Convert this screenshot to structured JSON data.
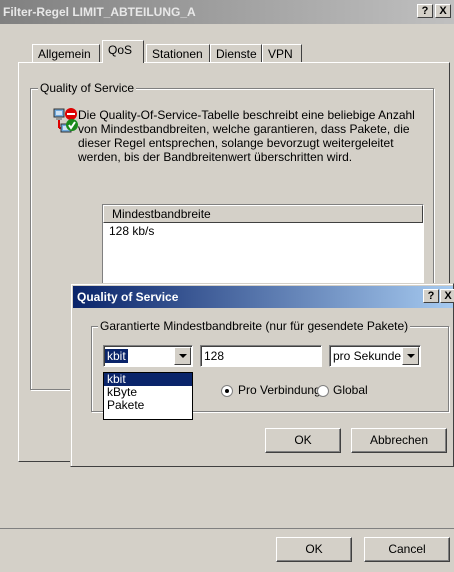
{
  "main_window": {
    "title": "Filter-Regel LIMIT_ABTEILUNG_A",
    "help_button": "?",
    "close_button": "X",
    "tabs": [
      {
        "label": "Allgemein"
      },
      {
        "label": "QoS"
      },
      {
        "label": "Stationen"
      },
      {
        "label": "Dienste"
      },
      {
        "label": "VPN"
      }
    ],
    "group_title": "Quality of Service",
    "description": "Die Quality-Of-Service-Tabelle beschreibt eine beliebige Anzahl von Mindestbandbreiten, welche garantieren, dass Pakete, die dieser Regel entsprechen, solange bevorzugt weitergeleitet werden, bis der Bandbreitenwert überschritten wird.",
    "table": {
      "column_header": "Mindestbandbreite",
      "rows": [
        "128 kb/s"
      ]
    },
    "ok_button": "OK",
    "cancel_button": "Cancel"
  },
  "dialog": {
    "title": "Quality of Service",
    "help_button": "?",
    "close_button": "X",
    "group_title": "Garantierte Mindestbandbreite (nur für gesendete Pakete)",
    "unit_selected": "kbit",
    "unit_options": [
      "kbit",
      "kByte",
      "Pakete"
    ],
    "value": "128",
    "period_selected": "pro Sekunde",
    "radio_per_connection": "Pro Verbindung",
    "radio_global": "Global",
    "radio_selected": "Pro Verbindung",
    "ok_button": "OK",
    "cancel_button": "Abbrechen"
  },
  "colors": {
    "dialog_title_start": "#0a246a",
    "dialog_title_end": "#a6caf0",
    "selection": "#0a246a",
    "inactive_title_start": "#808080"
  }
}
